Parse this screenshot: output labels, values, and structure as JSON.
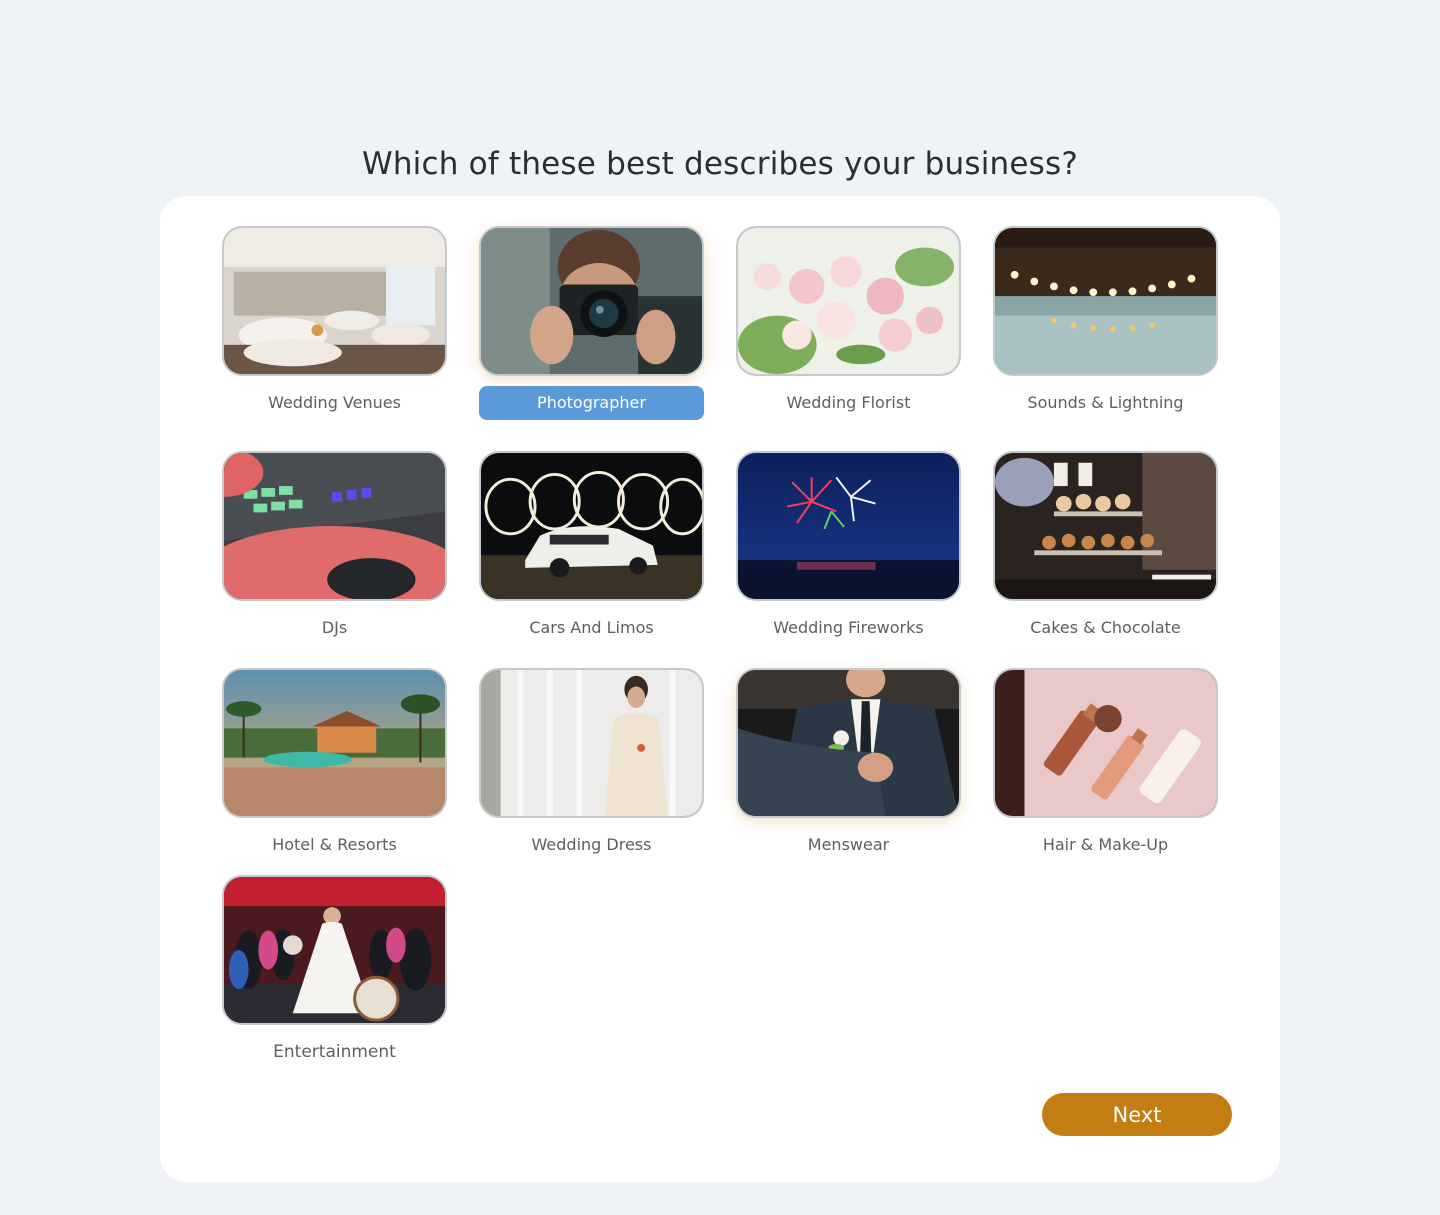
{
  "page_title": "Which of these best describes your business?",
  "selected_category": "Photographer",
  "categories": [
    {
      "label": "Wedding Venues",
      "selected": false
    },
    {
      "label": "Photographer",
      "selected": true
    },
    {
      "label": "Wedding Florist",
      "selected": false
    },
    {
      "label": "Sounds & Lightning",
      "selected": false
    },
    {
      "label": "DJs",
      "selected": false
    },
    {
      "label": "Cars And Limos",
      "selected": false
    },
    {
      "label": "Wedding Fireworks",
      "selected": false
    },
    {
      "label": "Cakes & Chocolate",
      "selected": false
    },
    {
      "label": "Hotel & Resorts",
      "selected": false
    },
    {
      "label": "Wedding Dress",
      "selected": false
    },
    {
      "label": "Menswear",
      "selected": false
    },
    {
      "label": "Hair & Make-Up",
      "selected": false
    },
    {
      "label": "Entertainment",
      "selected": false
    }
  ],
  "next_button": {
    "label": "Next"
  },
  "colors": {
    "background": "#eff2f7",
    "panel": "#ffffff",
    "selected_label": "#5b9ad8",
    "next_button": "#c27d13",
    "title_text": "#2b2d33",
    "label_text": "#5b5e63"
  }
}
